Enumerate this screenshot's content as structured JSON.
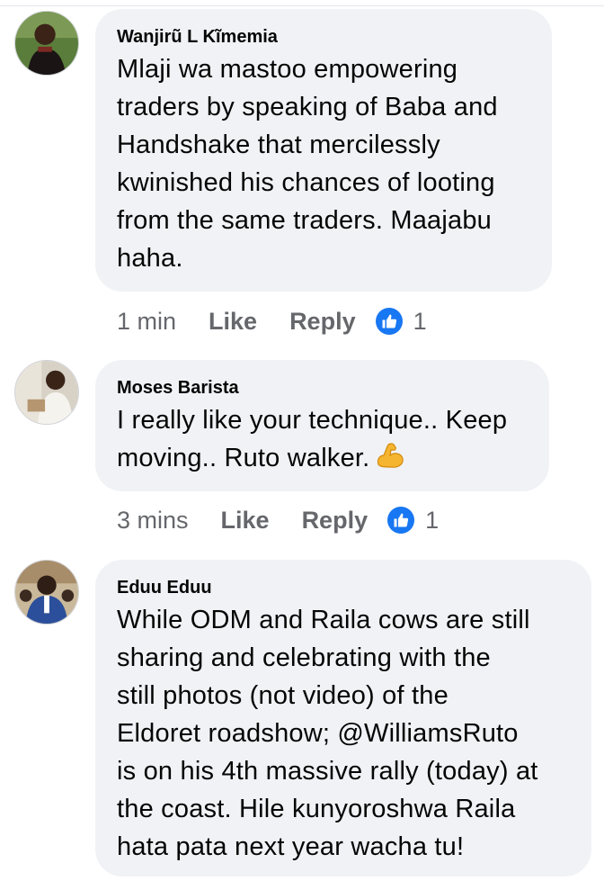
{
  "comments": [
    {
      "author": "Wanjirũ L Kĩmemia",
      "lines": [
        "Mlaji wa mastoo empowering",
        "traders by speaking of Baba and",
        "Handshake that mercilessly",
        "kwinished his chances of looting",
        "from the same traders. Maajabu",
        "haha."
      ],
      "time": "1 min",
      "like_label": "Like",
      "reply_label": "Reply",
      "reaction_count": "1"
    },
    {
      "author": "Moses Barista",
      "lines": [
        "I really like your technique.. Keep",
        "moving.. Ruto walker."
      ],
      "emoji": "flexed-biceps-icon",
      "time": "3 mins",
      "like_label": "Like",
      "reply_label": "Reply",
      "reaction_count": "1"
    },
    {
      "author": "Eduu Eduu",
      "lines": [
        "While ODM and Raila cows are still",
        "sharing and celebrating with the",
        "still photos (not video) of the",
        "Eldoret roadshow; @WilliamsRuto",
        "is on his 4th massive rally (today) at",
        "the coast. Hile kunyoroshwa Raila",
        "hata pata next year wacha tu!"
      ]
    }
  ],
  "colors": {
    "bubble": "#f0f2f5",
    "meta_text": "#65676b",
    "like_blue": "#1877f2"
  }
}
